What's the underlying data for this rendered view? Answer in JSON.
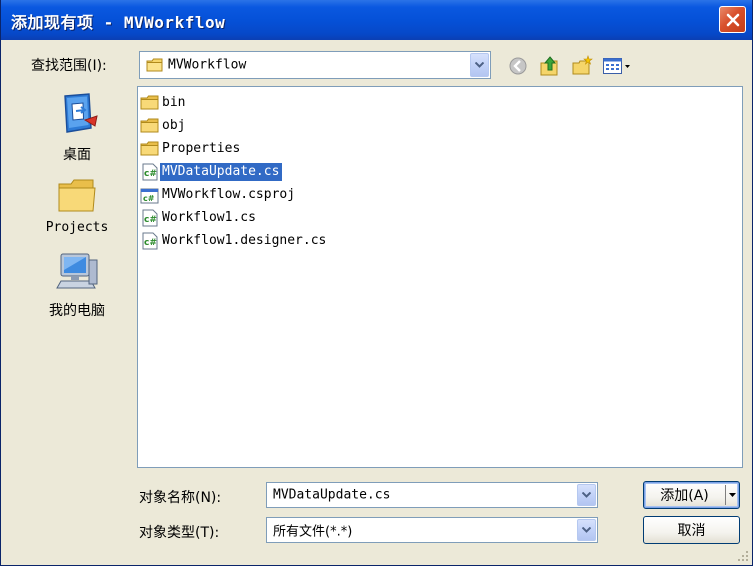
{
  "window": {
    "title": "添加现有项 - MVWorkflow"
  },
  "lookin": {
    "label": "查找范围(I):",
    "value": "MVWorkflow"
  },
  "toolbar": {
    "icons": [
      "back-icon",
      "up-folder-icon",
      "new-folder-icon",
      "view-menu-icon"
    ]
  },
  "places": [
    {
      "label": "桌面",
      "icon": "desktop-icon"
    },
    {
      "label": "Projects",
      "icon": "folder-icon"
    },
    {
      "label": "我的电脑",
      "icon": "my-computer-icon"
    }
  ],
  "files": [
    {
      "name": "bin",
      "type": "folder"
    },
    {
      "name": "obj",
      "type": "folder"
    },
    {
      "name": "Properties",
      "type": "folder"
    },
    {
      "name": "MVDataUpdate.cs",
      "type": "cs",
      "selected": true
    },
    {
      "name": "MVWorkflow.csproj",
      "type": "csproj"
    },
    {
      "name": "Workflow1.cs",
      "type": "cs"
    },
    {
      "name": "Workflow1.designer.cs",
      "type": "cs"
    }
  ],
  "filename": {
    "label": "对象名称(N):",
    "value": "MVDataUpdate.cs"
  },
  "filetype": {
    "label": "对象类型(T):",
    "value": "所有文件(*.*)"
  },
  "buttons": {
    "add": "添加(A)",
    "cancel": "取消"
  },
  "colors": {
    "titlebar": "#0551d8",
    "selection": "#316ac5",
    "close": "#d8502c",
    "dialog": "#ece9d8"
  }
}
